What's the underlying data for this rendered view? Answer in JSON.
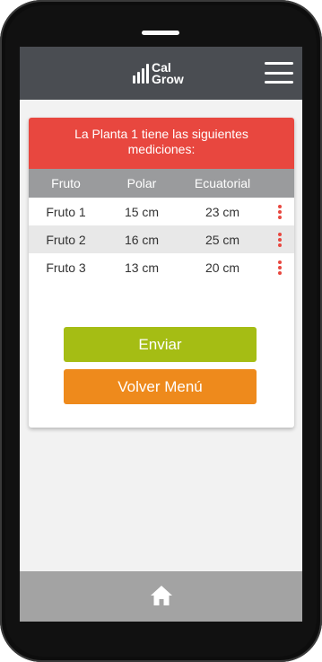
{
  "header": {
    "logo_line1": "Cal",
    "logo_line2": "Grow"
  },
  "card": {
    "title": "La Planta 1 tiene las siguientes mediciones:",
    "columns": [
      "Fruto",
      "Polar",
      "Ecuatorial"
    ],
    "rows": [
      {
        "fruto": "Fruto 1",
        "polar": "15 cm",
        "ecuatorial": "23 cm"
      },
      {
        "fruto": "Fruto 2",
        "polar": "16 cm",
        "ecuatorial": "25 cm"
      },
      {
        "fruto": "Fruto 3",
        "polar": "13 cm",
        "ecuatorial": "20 cm"
      }
    ]
  },
  "buttons": {
    "send": "Enviar",
    "back": "Volver Menú"
  },
  "icons": {
    "menu": "hamburger-menu-icon",
    "row_options": "kebab-menu-icon",
    "home": "home-icon"
  },
  "colors": {
    "header_bar": "#4a4d52",
    "title_bg": "#e8473f",
    "table_head": "#9a9b9d",
    "send_button": "#a5bd14",
    "back_button": "#ee8a1c",
    "bottom_bar": "#a3a3a3"
  }
}
